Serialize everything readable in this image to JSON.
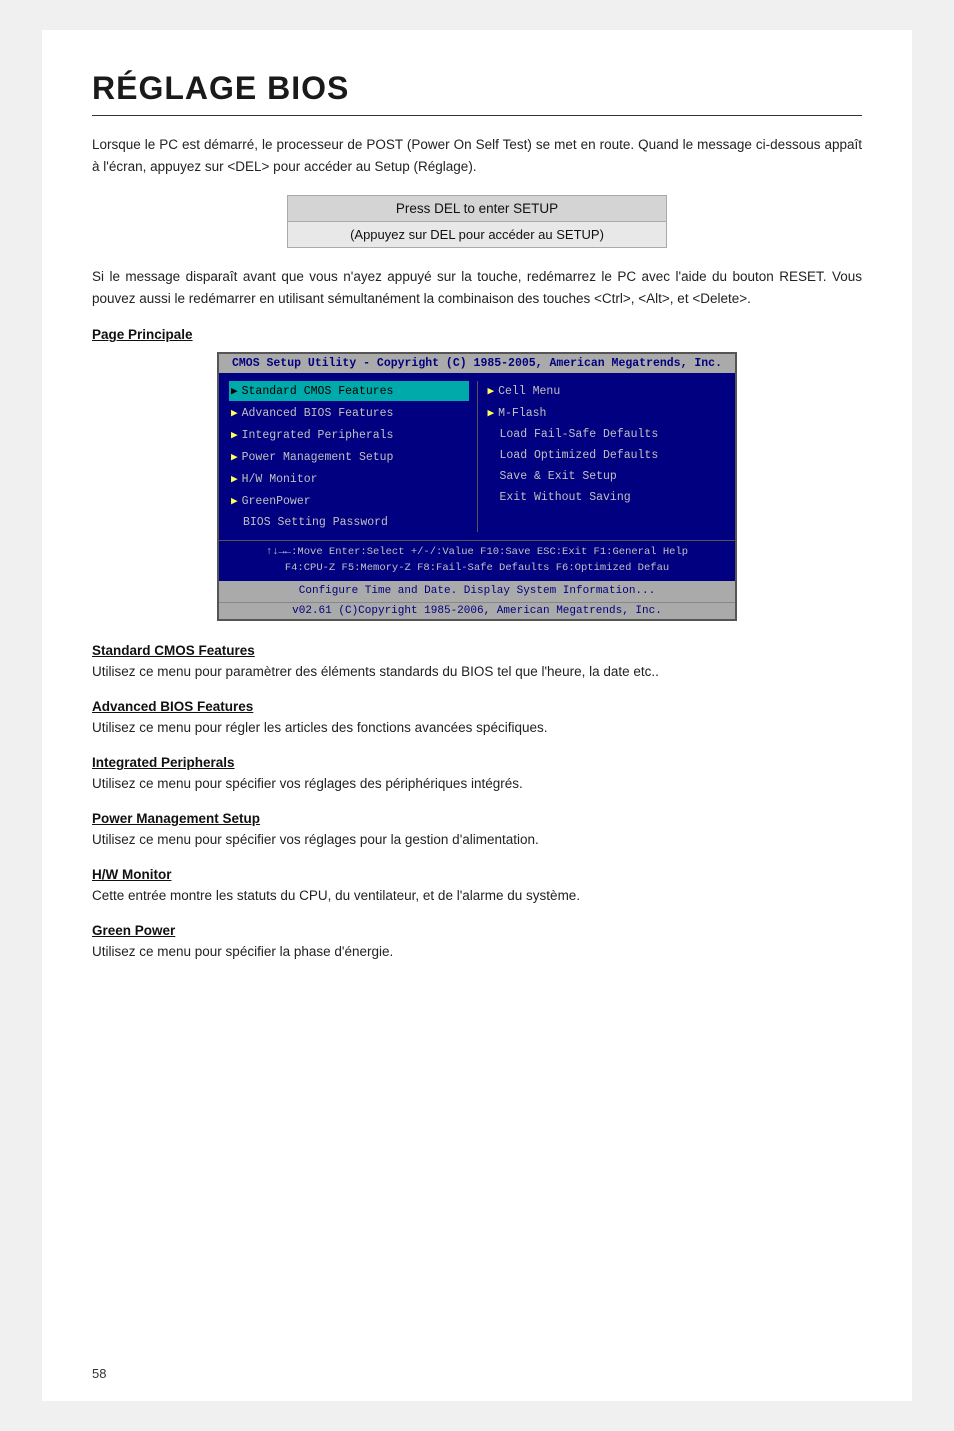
{
  "page": {
    "title": "RÉGLAGE BIOS",
    "page_number": "58",
    "intro": "Lorsque le PC est démarré, le processeur de POST (Power On Self Test) se met en route. Quand le message ci-dessous appaît à l'écran, appuyez sur <DEL> pour accéder au Setup (Réglage).",
    "press_del_top": "Press DEL to enter SETUP",
    "press_del_bottom": "(Appuyez sur DEL pour accéder au SETUP)",
    "second_paragraph": "Si le message disparaît avant que vous n'ayez appuyé sur la touche, redémarrez le PC avec l'aide du bouton RESET. Vous pouvez aussi le redémarrer en utilisant sémultanément la combinaison des touches <Ctrl>, <Alt>, et <Delete>.",
    "section_heading": "Page Principale",
    "bios": {
      "title_bar": "CMOS Setup Utility - Copyright (C) 1985-2005, American Megatrends, Inc.",
      "left_col": [
        {
          "label": "Standard CMOS Features",
          "arrow": true,
          "selected": true
        },
        {
          "label": "Advanced BIOS Features",
          "arrow": true,
          "selected": false
        },
        {
          "label": "Integrated Peripherals",
          "arrow": true,
          "selected": false
        },
        {
          "label": "Power Management Setup",
          "arrow": true,
          "selected": false
        },
        {
          "label": "H/W Monitor",
          "arrow": true,
          "selected": false
        },
        {
          "label": "GreenPower",
          "arrow": true,
          "selected": false
        },
        {
          "label": "BIOS Setting Password",
          "arrow": false,
          "selected": false
        }
      ],
      "right_col": [
        {
          "label": "Cell Menu",
          "arrow": true,
          "selected": false
        },
        {
          "label": "M-Flash",
          "arrow": true,
          "selected": false
        },
        {
          "label": "Load Fail-Safe Defaults",
          "arrow": false,
          "selected": false
        },
        {
          "label": "Load Optimized Defaults",
          "arrow": false,
          "selected": false
        },
        {
          "label": "Save & Exit Setup",
          "arrow": false,
          "selected": false
        },
        {
          "label": "Exit Without Saving",
          "arrow": false,
          "selected": false
        }
      ],
      "footer_line1": "↑↓→←:Move  Enter:Select  +/-/:Value  F10:Save  ESC:Exit  F1:General Help",
      "footer_line2": "F4:CPU-Z    F5:Memory-Z    F8:Fail-Safe Defaults    F6:Optimized Defau",
      "bottom1": "Configure Time and Date.  Display System Information...",
      "bottom2": "v02.61 (C)Copyright 1985-2006, American Megatrends, Inc."
    },
    "sections": [
      {
        "heading": "Standard CMOS Features",
        "text": "Utilisez ce menu pour paramètrer des éléments standards du BIOS tel que l'heure, la date etc.."
      },
      {
        "heading": "Advanced BIOS Features",
        "text": "Utilisez ce menu pour régler les articles des fonctions avancées spécifiques."
      },
      {
        "heading": "Integrated Peripherals",
        "text": "Utilisez ce menu pour spécifier vos réglages des périphériques intégrés."
      },
      {
        "heading": "Power Management Setup",
        "text": "Utilisez ce menu pour spécifier vos réglages pour la gestion d'alimentation."
      },
      {
        "heading": "H/W Monitor",
        "text": "Cette entrée montre les statuts du CPU, du ventilateur, et de l'alarme du système."
      },
      {
        "heading": "Green Power",
        "text": "Utilisez ce menu pour spécifier la phase d'énergie."
      }
    ]
  }
}
